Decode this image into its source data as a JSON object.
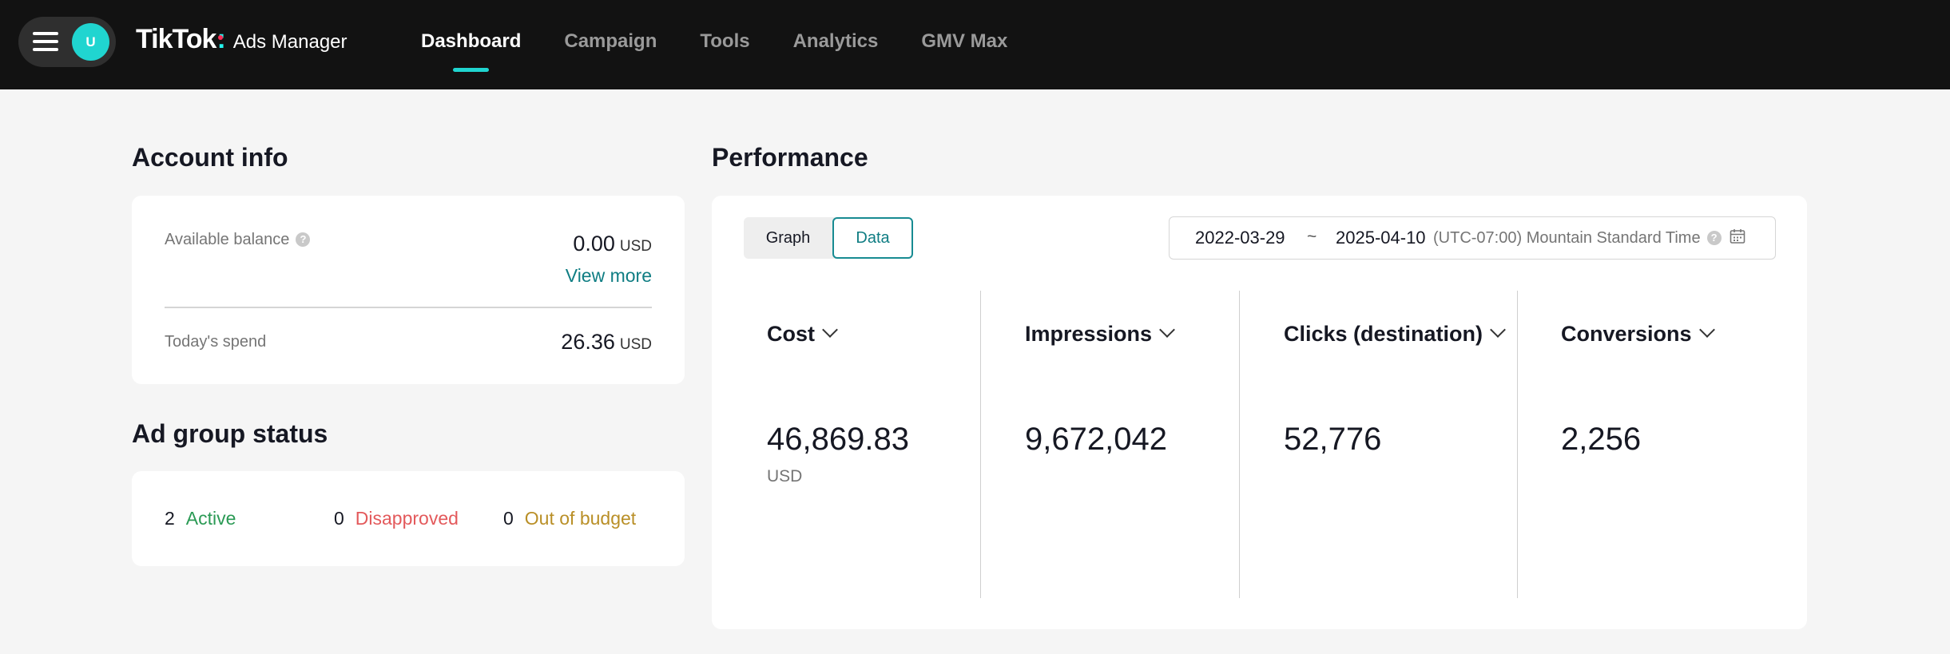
{
  "header": {
    "avatar_initial": "U",
    "logo_main": "TikTok",
    "logo_sub": "Ads Manager",
    "nav": [
      {
        "label": "Dashboard",
        "active": true
      },
      {
        "label": "Campaign",
        "active": false
      },
      {
        "label": "Tools",
        "active": false
      },
      {
        "label": "Analytics",
        "active": false
      },
      {
        "label": "GMV Max",
        "active": false
      }
    ]
  },
  "account_info": {
    "title": "Account info",
    "available_balance_label": "Available balance",
    "available_balance_value": "0.00",
    "available_balance_unit": "USD",
    "view_more": "View more",
    "todays_spend_label": "Today's spend",
    "todays_spend_value": "26.36",
    "todays_spend_unit": "USD"
  },
  "ad_group_status": {
    "title": "Ad group status",
    "items": [
      {
        "count": "2",
        "label": "Active"
      },
      {
        "count": "0",
        "label": "Disapproved"
      },
      {
        "count": "0",
        "label": "Out of budget"
      }
    ]
  },
  "performance": {
    "title": "Performance",
    "view_toggle": {
      "graph": "Graph",
      "data": "Data",
      "selected": "Data"
    },
    "date_range": {
      "start": "2022-03-29",
      "separator": "~",
      "end": "2025-04-10",
      "timezone": "(UTC-07:00) Mountain Standard Time"
    },
    "metrics": [
      {
        "label": "Cost",
        "value": "46,869.83",
        "unit": "USD"
      },
      {
        "label": "Impressions",
        "value": "9,672,042"
      },
      {
        "label": "Clicks (destination)",
        "value": "52,776"
      },
      {
        "label": "Conversions",
        "value": "2,256"
      }
    ]
  },
  "colors": {
    "accent": "#20d5d0",
    "link": "#0f7d83",
    "active": "#2b9a55",
    "disapproved": "#e3595b",
    "out_of_budget": "#b98f27"
  }
}
